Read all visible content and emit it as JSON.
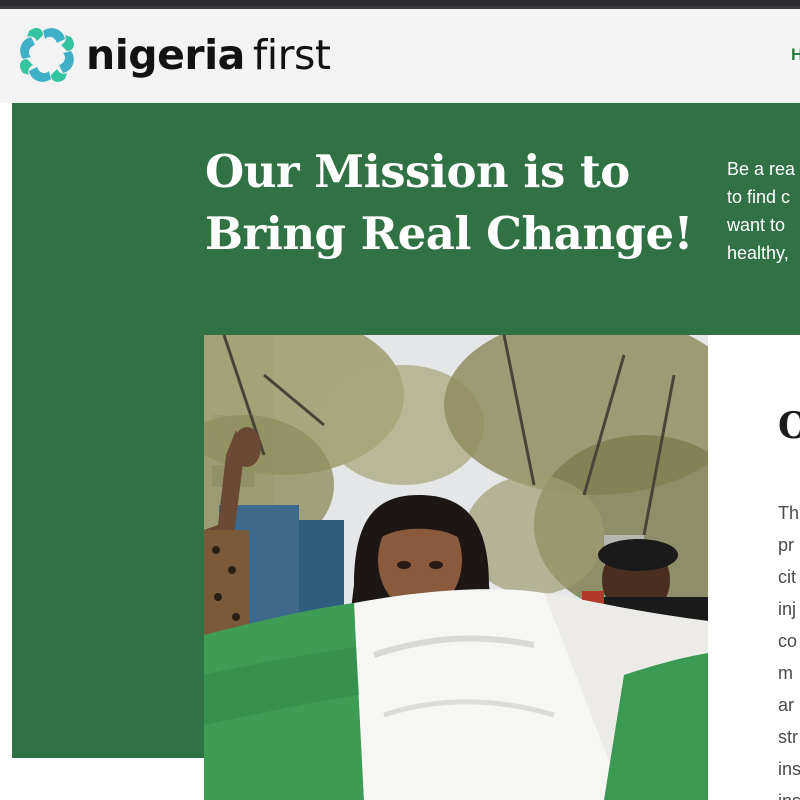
{
  "header": {
    "logo": {
      "word1": "nigeria",
      "word2": "first",
      "icon": "four-hands-logo-icon"
    },
    "nav": {
      "first_item": "H"
    }
  },
  "hero": {
    "title_line1": "Our Mission is to",
    "title_line2": "Bring Real Change!",
    "desc_lines": [
      "Be a rea",
      "to find c",
      "want to",
      "healthy,"
    ]
  },
  "feature": {
    "image_icon": "protest-flag-photo",
    "heading": "O",
    "body_lines": [
      "Th",
      "pr",
      "cit",
      "inj",
      "co",
      "m",
      "ar",
      "str",
      "ins",
      "ins"
    ]
  },
  "colors": {
    "brand_green": "#317244",
    "nav_green": "#2f7a42",
    "logo_teal": "#3fb0c8",
    "header_bg": "#f3f3f3"
  }
}
